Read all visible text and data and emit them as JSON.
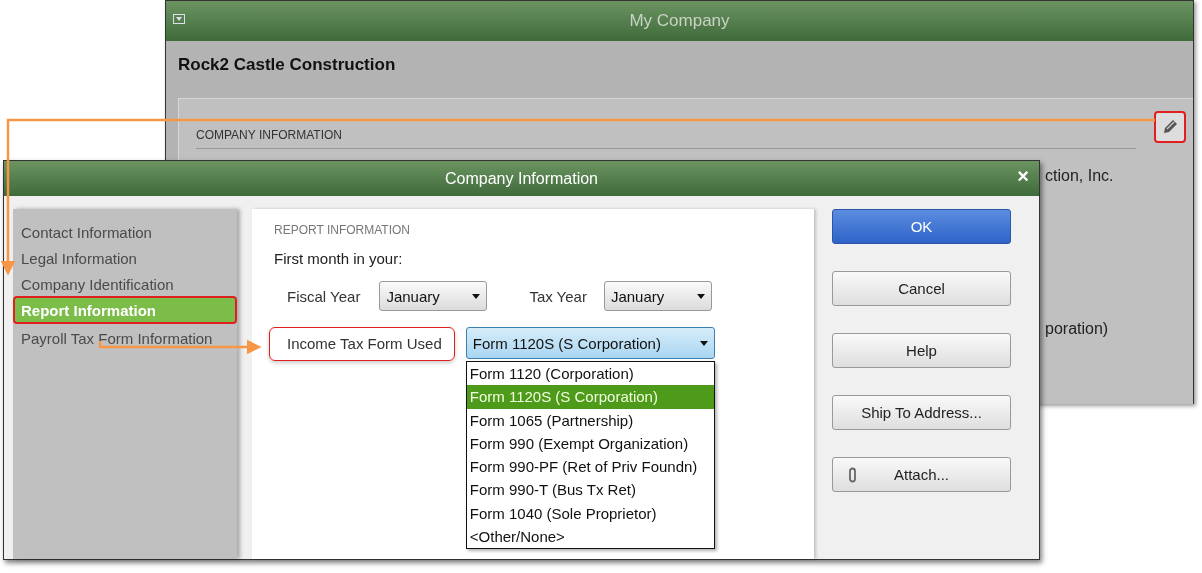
{
  "back_window": {
    "title": "My Company",
    "company_name": "Rock2 Castle Construction",
    "section_heading": "COMPANY INFORMATION",
    "edit_annotated": true,
    "visible_fragments": [
      "ction, Inc.",
      "poration)"
    ]
  },
  "dialog": {
    "title": "Company Information",
    "close": "×",
    "sidebar": {
      "items": [
        {
          "label": "Contact Information",
          "selected": false,
          "annotated": false
        },
        {
          "label": "Legal Information",
          "selected": false,
          "annotated": false
        },
        {
          "label": "Company Identification",
          "selected": false,
          "annotated": false
        },
        {
          "label": "Report Information",
          "selected": true,
          "annotated": true
        },
        {
          "label": "Payroll Tax Form Information",
          "selected": false,
          "annotated": false
        }
      ]
    },
    "report": {
      "heading": "REPORT INFORMATION",
      "prompt": "First month in your:",
      "fiscal_year": {
        "label": "Fiscal Year",
        "value": "January"
      },
      "tax_year": {
        "label": "Tax Year",
        "value": "January"
      },
      "income_tax_form": {
        "label": "Income Tax Form Used",
        "label_annotated": true,
        "value": "Form 1120S (S Corporation)",
        "expanded": true,
        "options": [
          {
            "label": "Form 1120 (Corporation)",
            "selected": false
          },
          {
            "label": "Form 1120S (S Corporation)",
            "selected": true
          },
          {
            "label": "Form 1065 (Partnership)",
            "selected": false
          },
          {
            "label": "Form 990 (Exempt Organization)",
            "selected": false
          },
          {
            "label": "Form 990-PF (Ret of Priv Foundn)",
            "selected": false
          },
          {
            "label": "Form 990-T (Bus Tx Ret)",
            "selected": false
          },
          {
            "label": "Form 1040 (Sole Proprietor)",
            "selected": false
          },
          {
            "label": "<Other/None>",
            "selected": false
          }
        ]
      }
    },
    "buttons": [
      {
        "label": "OK",
        "kind": "primary"
      },
      {
        "label": "Cancel",
        "kind": "default"
      },
      {
        "label": "Help",
        "kind": "default"
      },
      {
        "label": "Ship To Address...",
        "kind": "default"
      },
      {
        "label": "Attach...",
        "kind": "attach"
      }
    ]
  }
}
